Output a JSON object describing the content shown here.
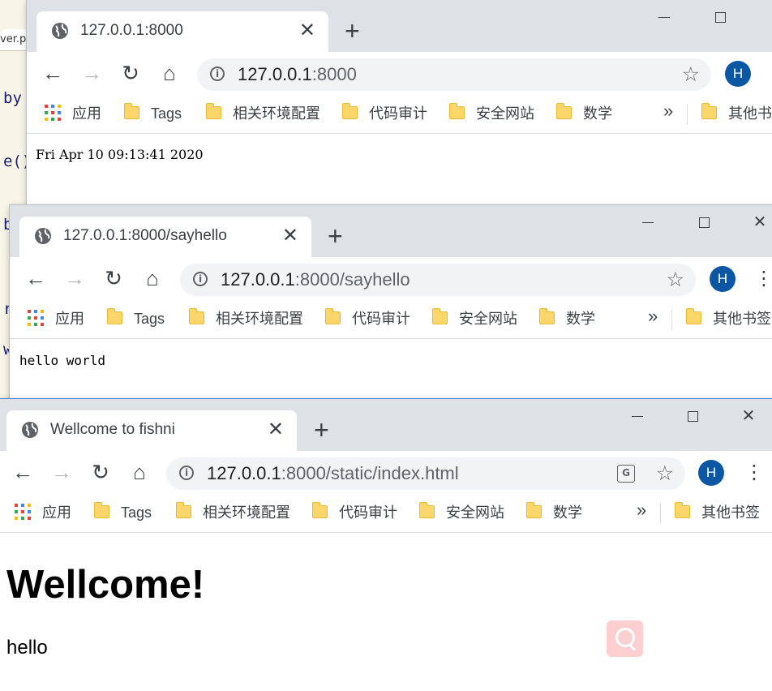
{
  "editor": {
    "tab": "ver.py",
    "code": [
      "by",
      "e()",
      "b",
      "r_",
      "w"
    ]
  },
  "windows": [
    {
      "tab_title": "127.0.0.1:8000",
      "url_host": "127.0.0.1",
      "url_rest": ":8000",
      "avatar": "H",
      "body_text": "Fri Apr 10 09:13:41 2020"
    },
    {
      "tab_title": "127.0.0.1:8000/sayhello",
      "url_host": "127.0.0.1",
      "url_rest": ":8000/sayhello",
      "avatar": "H",
      "body_text": "hello world"
    },
    {
      "tab_title": "Wellcome to fishni",
      "url_host": "127.0.0.1",
      "url_rest": ":8000/static/index.html",
      "avatar": "H",
      "heading": "Wellcome!",
      "paragraph": "hello"
    }
  ],
  "bookmarks": {
    "apps_label": "应用",
    "items": [
      "Tags",
      "相关环境配置",
      "代码审计",
      "安全网站",
      "数学"
    ],
    "overflow": "»",
    "other": "其他书签"
  },
  "glyphs": {
    "close": "✕",
    "new_tab": "+",
    "back": "←",
    "forward": "→",
    "reload": "↻",
    "home": "⌂",
    "star": "☆",
    "menu": "⋮",
    "info": "i",
    "translate": "G",
    "min": "",
    "win_close": "✕"
  },
  "colors": {
    "tabstrip": "#dee1e6",
    "avatar": "#0b57a4",
    "folder": "#fbd66a"
  }
}
